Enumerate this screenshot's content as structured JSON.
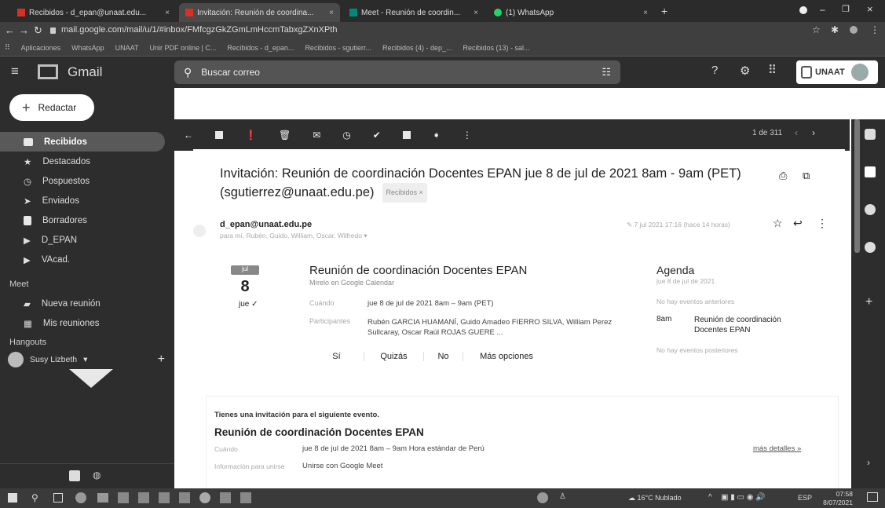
{
  "browser": {
    "tabs": [
      {
        "label": "Recibidos - d_epan@unaat.edu...",
        "close": "×"
      },
      {
        "label": "Invitación: Reunión de coordina...",
        "close": "×"
      },
      {
        "label": "Meet - Reunión de coordin...",
        "close": "×"
      },
      {
        "label": "(1) WhatsApp",
        "close": "×"
      }
    ],
    "new_tab": "+",
    "url": "mail.google.com/mail/u/1/#inbox/FMfcgzGkZGmLmHccmTabxgZXnXPth",
    "bookmarks": [
      "Aplicaciones",
      "WhatsApp",
      "UNAAT",
      "Unir PDF online | C...",
      "Recibidos - d_epan...",
      "Recibidos - sgutierr...",
      "Recibidos (4) - dep_...",
      "Recibidos (13) - sal..."
    ]
  },
  "gmail": {
    "logo": "Gmail",
    "search_placeholder": "Buscar correo",
    "account_badge": "UNAAT",
    "compose": "Redactar",
    "nav": [
      {
        "label": "Recibidos",
        "icon": "inbox-icon"
      },
      {
        "label": "Destacados",
        "icon": "star-icon"
      },
      {
        "label": "Pospuestos",
        "icon": "clock-icon"
      },
      {
        "label": "Enviados",
        "icon": "send-icon"
      },
      {
        "label": "Borradores",
        "icon": "draft-icon"
      },
      {
        "label": "D_EPAN",
        "icon": "label-icon"
      },
      {
        "label": "VAcad.",
        "icon": "label-icon"
      }
    ],
    "meet_header": "Meet",
    "meet_items": [
      "Nueva reunión",
      "Mis reuniones"
    ],
    "hangouts_header": "Hangouts",
    "hangouts_user": "Susy Lizbeth",
    "pager": "1 de 311"
  },
  "email": {
    "subject": "Invitación: Reunión de coordinación Docentes EPAN jue 8 de jul de 2021 8am - 9am (PET)",
    "subject_line2": "(sgutierrez@unaat.edu.pe)",
    "label_chip": "Recibidos ×",
    "sender": "d_epan@unaat.edu.pe",
    "recipients": "para mí, Rubén, Guido, William, Oscar, Wilfredo",
    "date": "7 jul 2021 17:16 (hace 14 horas)",
    "cal": {
      "month": "jul",
      "day": "8",
      "weekday": "jue"
    },
    "event_title": "Reunión de coordinación Docentes EPAN",
    "view_in_calendar": "Mírelo en Google Calendar",
    "when_label": "Cuándo",
    "when_value": "jue 8 de jul de 2021 8am – 9am (PET)",
    "participants_label": "Participantes",
    "participants_value": "Rubén GARCIA HUAMANÍ, Guido Amadeo FIERRO SILVA, William Perez Sullcaray, Oscar Raúl ROJAS GUERE ...",
    "rsvp": [
      "Sí",
      "Quizás",
      "No",
      "Más opciones"
    ],
    "agenda_title": "Agenda",
    "agenda_date": "jue 8 de jul de 2021",
    "agenda_no_before": "No hay eventos anteriores",
    "agenda_time": "8am",
    "agenda_event": "Reunión de coordinación Docentes EPAN",
    "agenda_no_after": "No hay eventos posteriores",
    "invite_intro": "Tienes una invitación para el siguiente evento.",
    "body_title": "Reunión de coordinación Docentes EPAN",
    "body_when_label": "Cuándo",
    "body_when_value": "jue 8 de jul de 2021 8am – 9am Hora estándar de Perú",
    "more_details": "más detalles »",
    "join_label": "Información para unirse",
    "join_value": "Unirse con Google Meet"
  },
  "taskbar": {
    "weather": "16°C Nublado",
    "lang": "ESP",
    "time": "07:58",
    "date": "8/07/2021"
  },
  "colors": {
    "accent": "#d93025",
    "chrome_dark": "#2d2d2d"
  }
}
